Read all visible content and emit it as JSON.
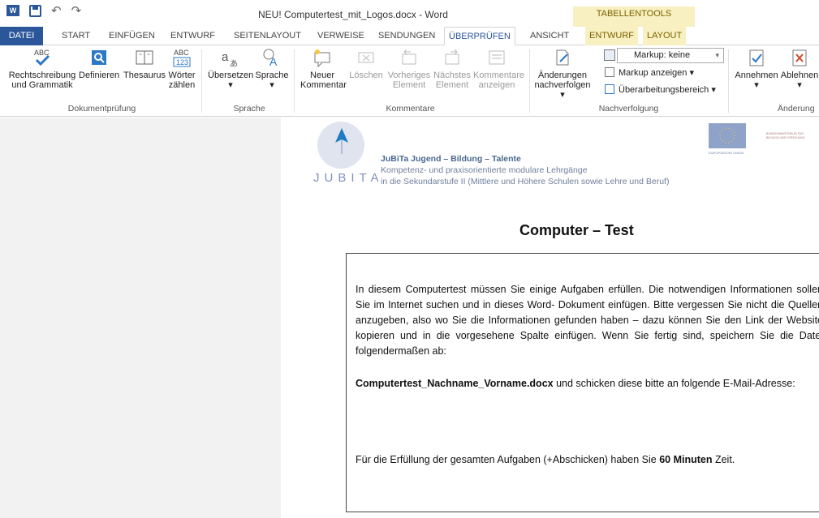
{
  "window": {
    "title": "NEU! Computertest_mit_Logos.docx - Word",
    "contextual_group": "TABELLENTOOLS"
  },
  "tabs": [
    "DATEI",
    "START",
    "EINFÜGEN",
    "ENTWURF",
    "SEITENLAYOUT",
    "VERWEISE",
    "SENDUNGEN",
    "ÜBERPRÜFEN",
    "ANSICHT",
    "ENTWURF",
    "LAYOUT"
  ],
  "ribbon": {
    "commands": {
      "spelling_1": "Rechtschreibung",
      "spelling_2": "und Grammatik",
      "define": "Definieren",
      "thesaurus": "Thesaurus",
      "wordcount_1": "Wörter",
      "wordcount_2": "zählen",
      "translate": "Übersetzen",
      "language": "Sprache",
      "new_comment_1": "Neuer",
      "new_comment_2": "Kommentar",
      "delete": "Löschen",
      "prev_1": "Vorheriges",
      "prev_2": "Element",
      "next_1": "Nächstes",
      "next_2": "Element",
      "show_1": "Kommentare",
      "show_2": "anzeigen",
      "track_1": "Änderungen",
      "track_2": "nachverfolgen",
      "markup": "Markup: keine",
      "show_markup": "Markup anzeigen",
      "review_pane": "Überarbeitungsbereich",
      "accept": "Annehmen",
      "reject": "Ablehnen"
    },
    "groups": {
      "proofing": "Dokumentprüfung",
      "language": "Sprache",
      "comments": "Kommentare",
      "tracking": "Nachverfolgung",
      "changes": "Änderung"
    }
  },
  "document": {
    "header": {
      "brand": "JuBiTa",
      "brand_rest": " Jugend – Bildung – Talente",
      "line2": "Kompetenz- und praxisorientierte modulare Lehrgänge",
      "line3": "in die Sekundarstufe II (Mittlere und Höhere Schulen sowie Lehre und Beruf)",
      "logo_word": "JUBITA"
    },
    "title": "Computer – Test",
    "p1": "In diesem Computertest müssen Sie einige Aufgaben erfüllen. Die notwendigen Informationen sollen Sie im Internet suchen und in dieses Word- Dokument einfügen. Bitte vergessen Sie nicht die Quellen anzugeben, also wo Sie die Informationen gefunden haben – dazu können Sie den Link der Website kopieren und in die vorgesehene Spalte einfügen. Wenn Sie fertig sind, speichern Sie die Datei folgendermaßen ab:",
    "p2_bold": "Computertest_Nachname_Vorname.docx",
    "p2_rest": " und schicken diese bitte an folgende E-Mail-Adresse:",
    "p3_start": "Für die Erfüllung der gesamten Aufgaben (+Abschicken) haben Sie ",
    "p3_bold": "60 Minuten",
    "p3_end": " Zeit."
  },
  "colors": {
    "word_blue": "#2b579a",
    "context_tab": "#f8f0c0"
  },
  "icons": [
    "word-logo-icon",
    "save-icon",
    "undo-icon",
    "redo-icon",
    "spelling-check-icon",
    "define-icon",
    "thesaurus-icon",
    "word-count-icon",
    "translate-icon",
    "language-icon",
    "new-comment-icon",
    "delete-comment-icon",
    "previous-comment-icon",
    "next-comment-icon",
    "show-comments-icon",
    "track-changes-icon",
    "markup-icon",
    "review-pane-icon",
    "accept-icon",
    "reject-icon",
    "jubita-logo-icon",
    "eu-flag-icon"
  ]
}
